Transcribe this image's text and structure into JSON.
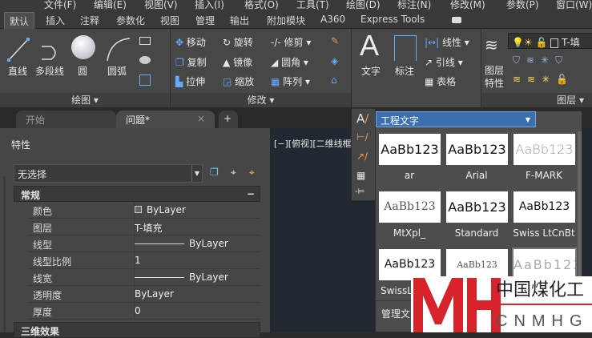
{
  "menu": [
    "文件(F)",
    "编辑(E)",
    "视图(V)",
    "插入(I)",
    "格式(O)",
    "工具(T)",
    "绘图(D)",
    "标注(N)",
    "修改(M)",
    "参数(P)",
    "窗口(W)"
  ],
  "ribbon_tabs": [
    "默认",
    "插入",
    "注释",
    "参数化",
    "视图",
    "管理",
    "输出",
    "附加模块",
    "A360",
    "Express Tools"
  ],
  "draw": {
    "line": "直线",
    "polyline": "多段线",
    "circle": "圆",
    "arc": "圆弧",
    "panel": "绘图 ▾"
  },
  "modify": {
    "move": "移动",
    "rotate": "旋转",
    "trim": "修剪",
    "copy": "复制",
    "mirror": "镜像",
    "fillet": "圆角",
    "stretch": "拉伸",
    "scale": "缩放",
    "array": "阵列",
    "panel": "修改 ▾"
  },
  "annot": {
    "text": "文字",
    "dim": "标注",
    "linear": "线性",
    "leader": "引线",
    "table": "表格"
  },
  "layers": {
    "props1": "图层",
    "props2": "特性",
    "current": "T-填",
    "panel": "图层 ▾"
  },
  "doc_tabs": {
    "start": "开始",
    "drawing": "问题*"
  },
  "properties": {
    "title": "特性",
    "selection": "无选择",
    "section_general": "常规",
    "section_3d": "三维效果",
    "rows": [
      {
        "k": "颜色",
        "v": "ByLayer"
      },
      {
        "k": "图层",
        "v": "T-填充"
      },
      {
        "k": "线型",
        "v": "ByLayer"
      },
      {
        "k": "线型比例",
        "v": "1"
      },
      {
        "k": "线宽",
        "v": "ByLayer"
      },
      {
        "k": "透明度",
        "v": "ByLayer"
      },
      {
        "k": "厚度",
        "v": "0"
      }
    ]
  },
  "viewport": {
    "label": "[−][俯视][二维线框"
  },
  "text_styles": {
    "current": "工程文字",
    "sample": "AaBb123",
    "styles": [
      "ar",
      "Arial",
      "F-MARK",
      "MtXpl_",
      "Standard",
      "Swiss LtCnBt",
      "SwissL",
      "",
      ""
    ],
    "manage": "管理文"
  },
  "logo": {
    "mark": "MH",
    "cn": "中国煤化工",
    "en": "CNMHG"
  }
}
